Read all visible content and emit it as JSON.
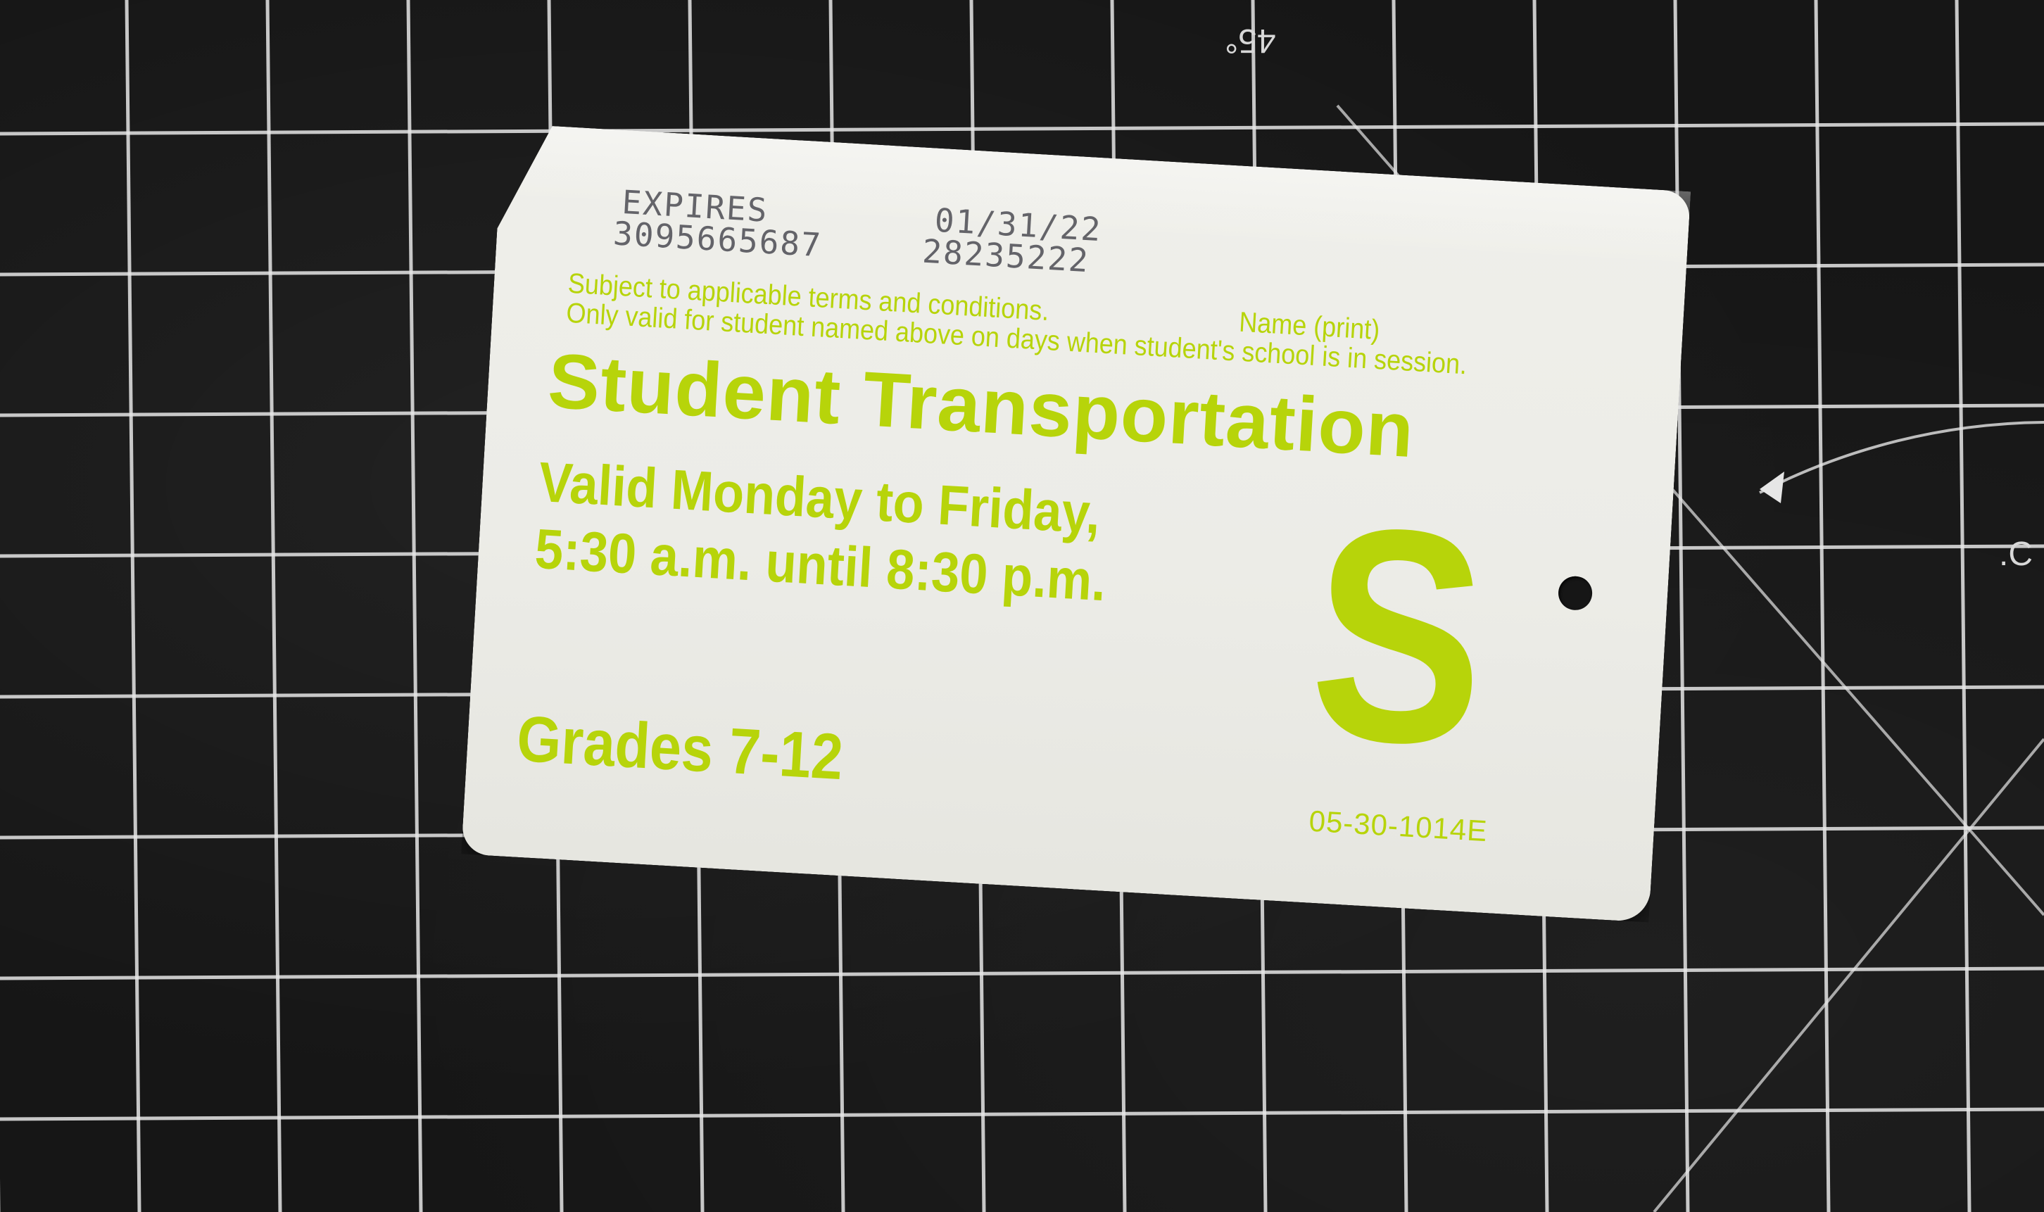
{
  "background": {
    "angle_label": "45°",
    "edge_label": ".C"
  },
  "card": {
    "expires_label": "EXPIRES",
    "expires_date": "01/31/22",
    "serial_left": "3095665687",
    "serial_right": "28235222",
    "terms_line_1": "Subject to applicable terms and conditions.",
    "name_print": "Name (print)",
    "terms_line_2": "Only valid for student named above on days when student's school is in session.",
    "title": "Student Transportation",
    "validity_line_1": "Valid Monday to Friday,",
    "validity_line_2": "5:30 a.m. until 8:30 p.m.",
    "grades": "Grades 7-12",
    "badge_letter": "S",
    "card_code": "05-30-1014E",
    "accent_color": "#b7d40a",
    "card_color": "#ecece7"
  }
}
